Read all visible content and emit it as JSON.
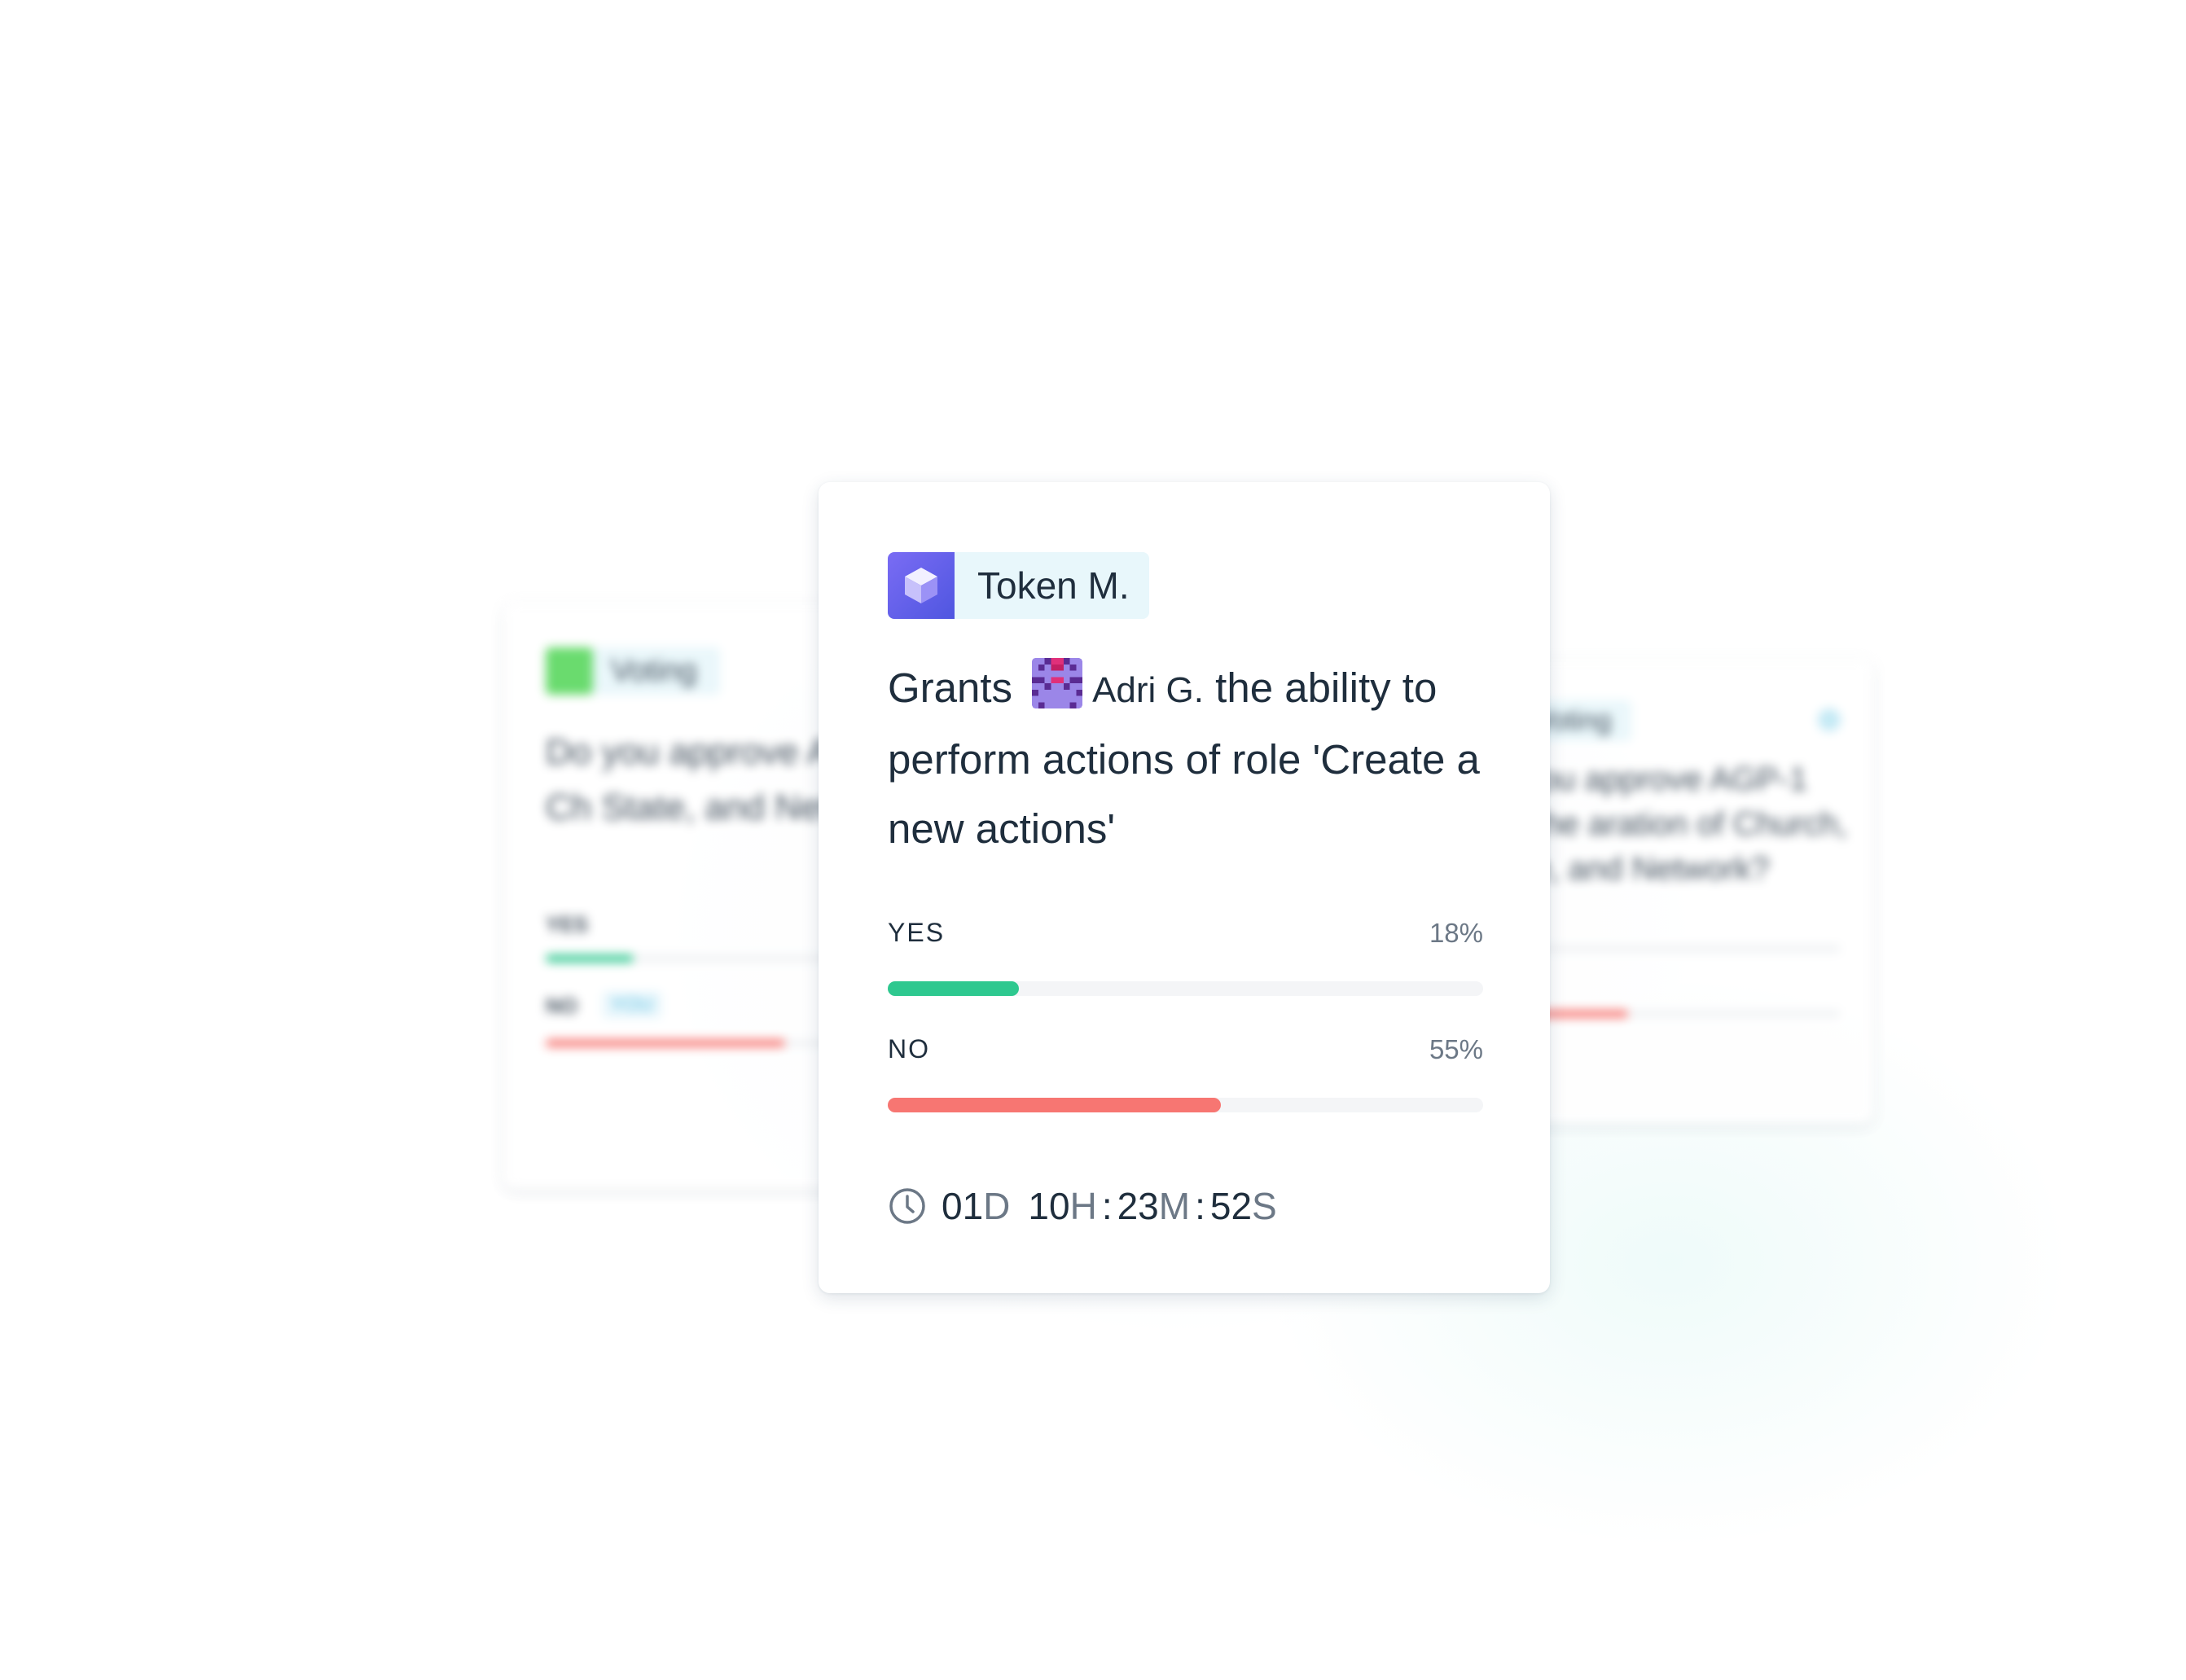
{
  "cards": {
    "left": {
      "tag_label": "Voting",
      "question": "Do you approve A Separation of Ch State, and Netwo",
      "yes_label": "YES",
      "no_label": "NO",
      "you_badge": "YOU",
      "yes_fraction": 0.18,
      "no_fraction": 0.49
    },
    "right": {
      "tag_label": "Voting",
      "question": "you approve AGP-1 The aration of Church, te, and Network?",
      "yes_fraction": 0.05,
      "no_fraction": 0.33
    },
    "main": {
      "token_label": "Token M.",
      "description_before": "Grants",
      "mention_name": "Adri G.",
      "description_after": "the ability to perform actions of role 'Create a new actions'",
      "yes": {
        "label": "YES",
        "percent_text": "18%",
        "fraction": 0.22
      },
      "no": {
        "label": "NO",
        "percent_text": "55%",
        "fraction": 0.56
      },
      "timer": {
        "days": "01",
        "days_unit": "D",
        "hours": "10",
        "hours_unit": "H",
        "minutes": "23",
        "minutes_unit": "M",
        "seconds": "52",
        "seconds_unit": "S",
        "separator": ":"
      }
    }
  },
  "colors": {
    "yes": "#2ec88f",
    "no": "#f77672",
    "accent_light": "#e8f7fb",
    "text": "#1f2e3d",
    "muted": "#6c7886"
  },
  "icons": {
    "token": "cube-icon",
    "mention": "identicon-avatar",
    "timer": "clock-icon",
    "voting": "voting-app-icon"
  }
}
